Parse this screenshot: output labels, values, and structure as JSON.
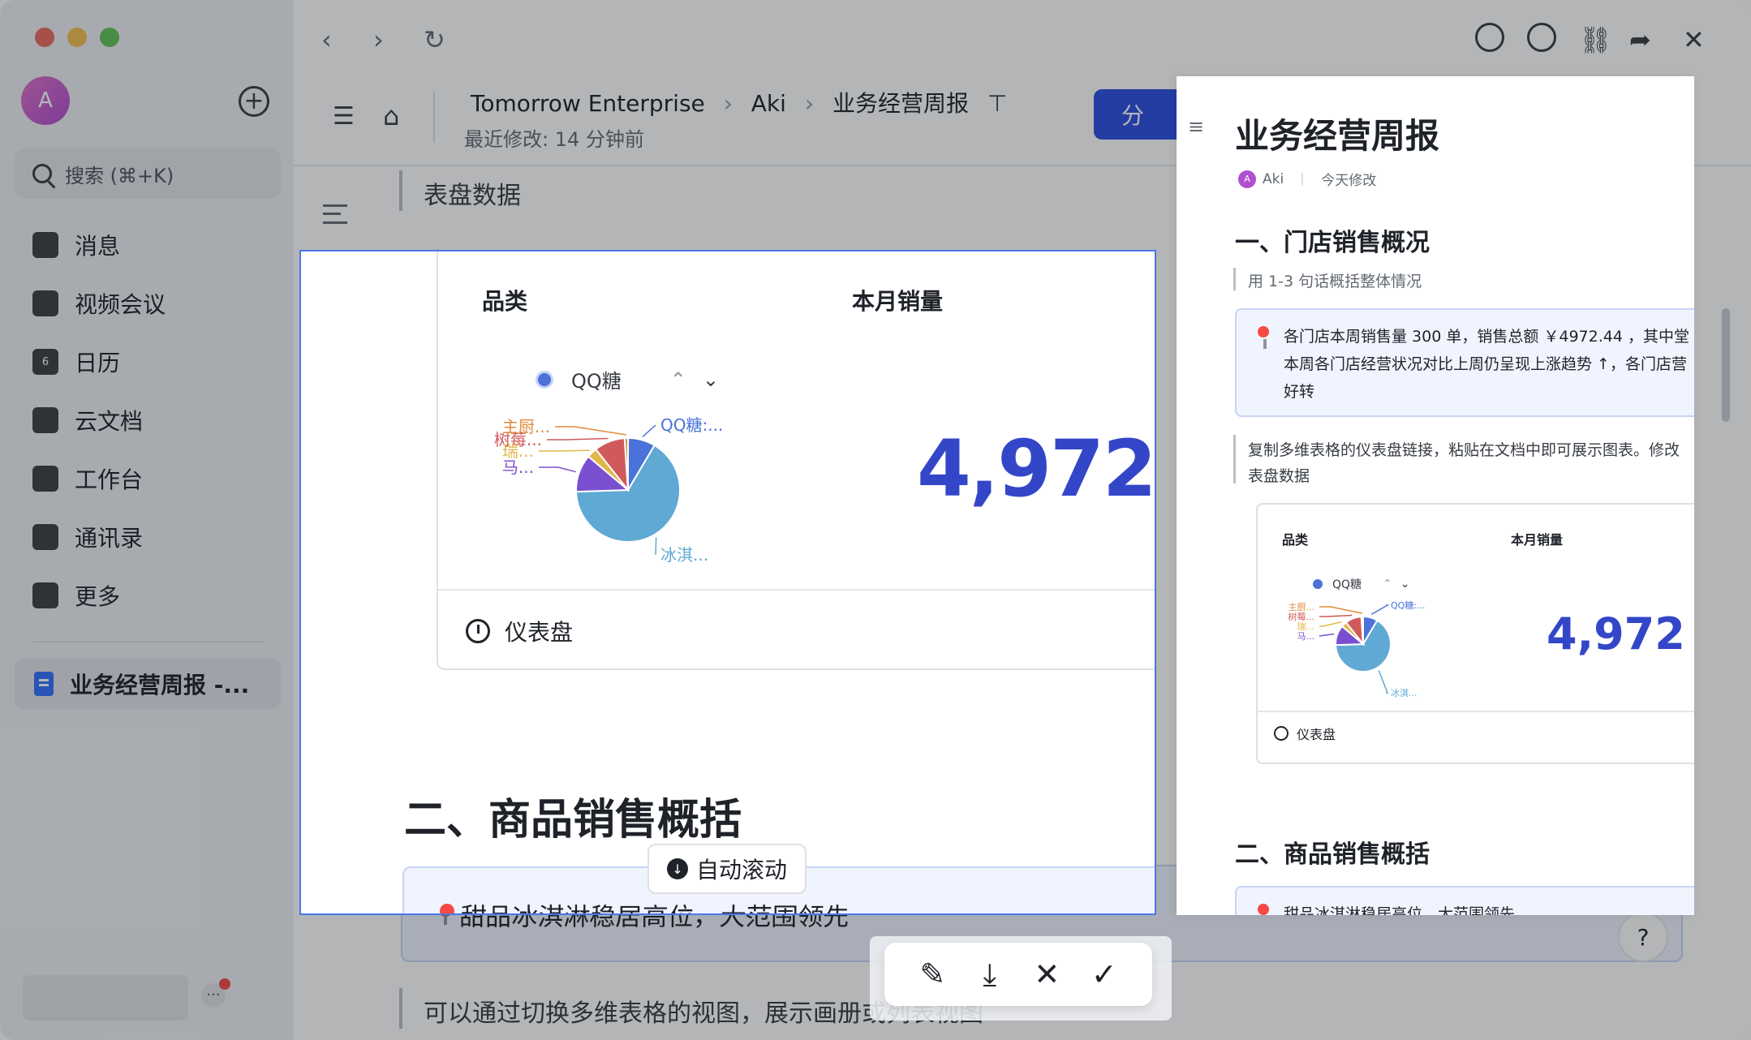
{
  "sidebar": {
    "avatar_letter": "A",
    "search_placeholder": "搜索 (⌘+K)",
    "nav": [
      "消息",
      "视频会议",
      "日历",
      "云文档",
      "工作台",
      "通讯录",
      "更多"
    ],
    "open_doc": "业务经营周报 -..."
  },
  "header": {
    "breadcrumb": [
      "Tomorrow Enterprise",
      "Aki",
      "业务经营周报"
    ],
    "modified": "最近修改: 14 分钟前",
    "share_label": "分"
  },
  "doc": {
    "text_before": "表盘数据",
    "dashboard": {
      "panel1_title": "品类",
      "legend_item": "QQ糖",
      "panel2_title": "本月销量",
      "big_number": "4,972",
      "footer_label": "仪表盘"
    },
    "section2_title": "二、商品销售概括",
    "callout_text": "甜品冰淇淋稳居高位，大范围领先",
    "bottom_text": "可以通过切换多维表格的视图，展示画册或列表视图"
  },
  "capture": {
    "auto_scroll": "自动滚动"
  },
  "preview": {
    "title": "业务经营周报",
    "author": "Aki",
    "author_initial": "A",
    "modified": "今天修改",
    "section1": "一、门店销售概况",
    "hint": "用 1-3 句话概括整体情况",
    "callout_line1": "各门店本周销售量 300 单，销售总额 ￥4972.44 ，其中堂",
    "callout_line2": "本周各门店经营状况对比上周仍呈现上涨趋势 ↑，各门店营",
    "callout_line3": "好转",
    "note_line1": "复制多维表格的仪表盘链接，粘贴在文档中即可展示图表。修改",
    "note_line2": "表盘数据",
    "section2": "二、商品销售概括",
    "callout2": "甜品冰淇淋稳居高位，大范围领先"
  },
  "chart_data": {
    "type": "pie",
    "title": "品类",
    "labels": [
      "QQ糖:...",
      "冰淇...",
      "马...",
      "瑞...",
      "树莓...",
      "主厨..."
    ],
    "values": [
      8,
      62,
      11,
      3,
      9,
      1
    ],
    "colors": [
      "#4a72d8",
      "#5fa9d4",
      "#7a4fd0",
      "#e0b84a",
      "#d05a5a",
      "#e08a3a"
    ],
    "label_colors": [
      "#4a72d8",
      "#5fa9d4",
      "#7a4fd0",
      "#e0b84a",
      "#d05a5a",
      "#e08a3a"
    ]
  },
  "colors": {
    "accent": "#3446c8",
    "selection": "#4a78e8",
    "brand": "#2b4fe0"
  }
}
